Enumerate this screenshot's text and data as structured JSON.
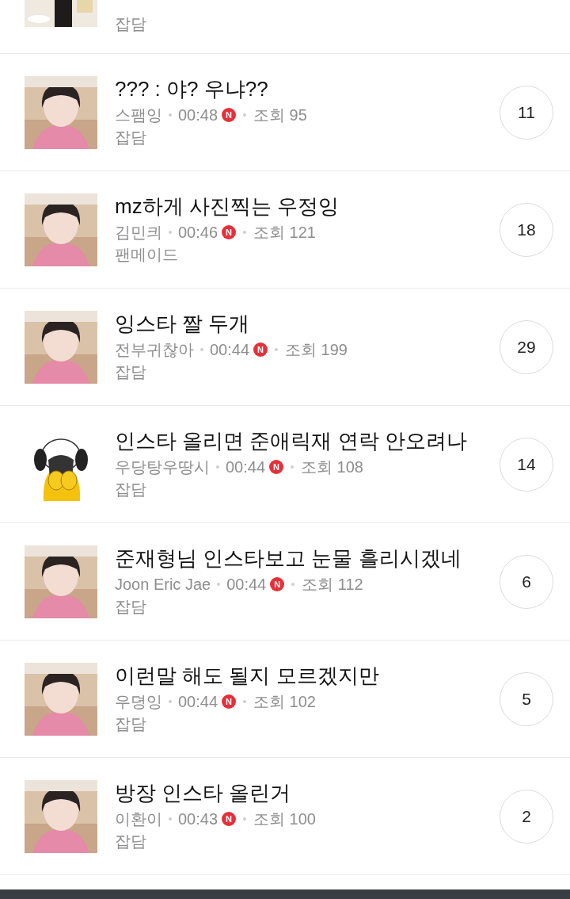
{
  "partial_post": {
    "thumbnail": {
      "kind": "scene"
    },
    "category": "잡담"
  },
  "posts": [
    {
      "title": "??? : 야? 우냐??",
      "author": "스팸잉",
      "time": "00:48",
      "badge": "N",
      "views": "조회 95",
      "category": "잡담",
      "comments": "11"
    },
    {
      "title": "mz하게 사진찍는 우정잉",
      "author": "김민킈",
      "time": "00:46",
      "badge": "N",
      "views": "조회 121",
      "category": "팬메이드",
      "comments": "18"
    },
    {
      "title": "잉스타 짤 두개",
      "author": "전부귀찮아",
      "time": "00:44",
      "badge": "N",
      "views": "조회 199",
      "category": "잡담",
      "comments": "29"
    },
    {
      "thumbnail": {
        "kind": "sticker"
      },
      "title": "인스타 올리면 준애릭재 연락 안오려나",
      "author": "우당탕우땅시",
      "time": "00:44",
      "badge": "N",
      "views": "조회 108",
      "category": "잡담",
      "comments": "14"
    },
    {
      "title": "준재형님 인스타보고 눈물 흘리시겠네",
      "author": "Joon Eric Jae",
      "time": "00:44",
      "badge": "N",
      "views": "조회 112",
      "category": "잡담",
      "comments": "6"
    },
    {
      "title": "이런말 해도 될지 모르겠지만",
      "author": "우뎡잉",
      "time": "00:44",
      "badge": "N",
      "views": "조회 102",
      "category": "잡담",
      "comments": "5"
    },
    {
      "title": "방장 인스타 올린거",
      "author": "이환이",
      "time": "00:43",
      "badge": "N",
      "views": "조회 100",
      "category": "잡담",
      "comments": "2"
    }
  ]
}
